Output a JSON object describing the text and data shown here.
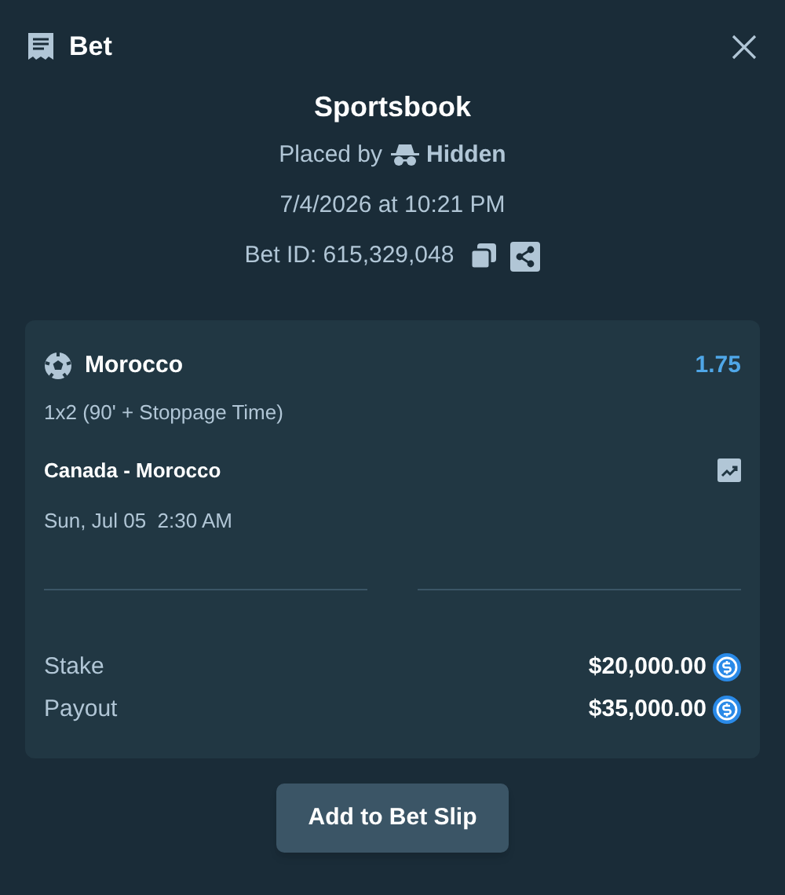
{
  "header": {
    "title": "Bet"
  },
  "title": "Sportsbook",
  "placed_by": {
    "label": "Placed by",
    "user": "Hidden"
  },
  "date": "7/4/2026 at 10:21 PM",
  "bet_id": "Bet ID: 615,329,048",
  "selection": {
    "name": "Morocco",
    "odds": "1.75",
    "market": "1x2 (90' + Stoppage Time)",
    "event": "Canada - Morocco",
    "start": "Sun, Jul 05  2:30 AM"
  },
  "totals": [
    {
      "label": "Stake",
      "amount": "$20,000.00"
    },
    {
      "label": "Payout",
      "amount": "$35,000.00"
    }
  ],
  "button": "Add to Bet Slip"
}
